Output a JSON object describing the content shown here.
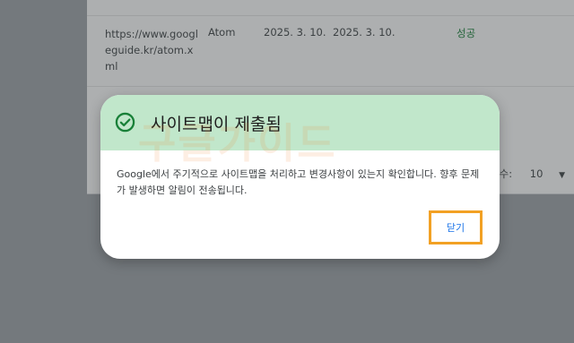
{
  "table": {
    "row": {
      "url": "https://www.googleguide.kr/atom.xml",
      "type": "Atom",
      "submitted": "2025. 3. 10.",
      "last_read": "2025. 3. 10.",
      "status": "성공"
    },
    "rows_per_page_label": "행 수:",
    "rows_per_page_value": "10"
  },
  "dialog": {
    "title": "사이트맵이 제출됨",
    "body": "Google에서 주기적으로 사이트맵을 처리하고 변경사항이 있는지 확인합니다. 향후 문제가 발생하면 알림이 전송됩니다.",
    "close_label": "닫기",
    "watermark_text": "구글가이드"
  },
  "colors": {
    "header_bg": "#c1e7cb",
    "success_green": "#188038",
    "button_text": "#1a73e8",
    "highlight": "#f2a124"
  },
  "icons": {
    "check": "check-circle-icon",
    "dropdown": "caret-down-icon"
  }
}
